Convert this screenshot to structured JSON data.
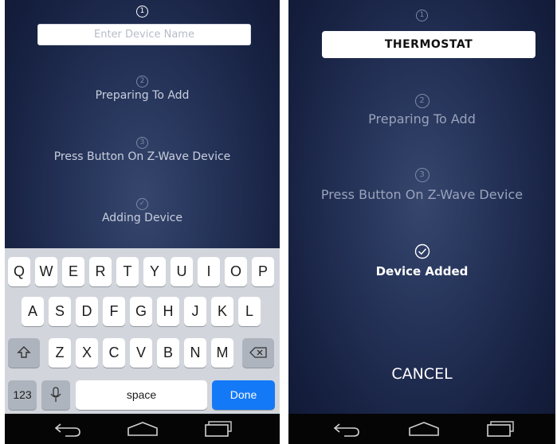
{
  "left": {
    "step1_num": "1",
    "name_placeholder": "Enter Device Name",
    "step2_num": "2",
    "step2_label": "Preparing To Add",
    "step3_num": "3",
    "step3_label": "Press Button On Z-Wave Device",
    "step4_label": "Adding Device",
    "keyboard": {
      "row1": [
        "Q",
        "W",
        "E",
        "R",
        "T",
        "Y",
        "U",
        "I",
        "O",
        "P"
      ],
      "row2": [
        "A",
        "S",
        "D",
        "F",
        "G",
        "H",
        "J",
        "K",
        "L"
      ],
      "row3": [
        "Z",
        "X",
        "C",
        "V",
        "B",
        "N",
        "M"
      ],
      "numbers_label": "123",
      "space_label": "space",
      "done_label": "Done"
    }
  },
  "right": {
    "step1_num": "1",
    "device_name": "THERMOSTAT",
    "step2_num": "2",
    "step2_label": "Preparing To Add",
    "step3_num": "3",
    "step3_label": "Press Button On Z-Wave Device",
    "added_label": "Device Added",
    "cancel_label": "CANCEL"
  },
  "icons": [
    "check-circle-icon",
    "shift-icon",
    "backspace-icon",
    "microphone-icon",
    "back-icon",
    "home-icon",
    "recents-icon"
  ]
}
